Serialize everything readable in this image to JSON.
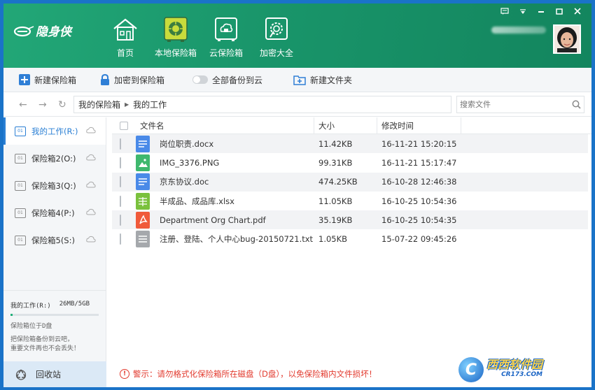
{
  "app": {
    "logo_mark": "e",
    "logo_text": "隐身侠"
  },
  "nav": [
    {
      "label": "首页",
      "icon": "home-icon"
    },
    {
      "label": "本地保险箱",
      "icon": "safe-icon"
    },
    {
      "label": "云保险箱",
      "icon": "cloud-safe-icon"
    },
    {
      "label": "加密大全",
      "icon": "encrypt-gear-icon"
    }
  ],
  "window_controls": [
    "message-icon",
    "dropdown-icon",
    "minimize-icon",
    "maximize-icon",
    "close-icon"
  ],
  "toolbar": {
    "new_vault": "新建保险箱",
    "encrypt_to_vault": "加密到保险箱",
    "backup_all": "全部备份到云",
    "new_folder": "新建文件夹"
  },
  "address": {
    "crumbs": [
      "我的保险箱",
      "我的工作"
    ],
    "search_placeholder": "搜索文件"
  },
  "sidebar": {
    "vaults": [
      {
        "label": "我的工作(R:)",
        "active": true
      },
      {
        "label": "保险箱2(O:)",
        "active": false
      },
      {
        "label": "保险箱3(Q:)",
        "active": false
      },
      {
        "label": "保险箱4(P:)",
        "active": false
      },
      {
        "label": "保险箱5(S:)",
        "active": false
      }
    ],
    "usage": {
      "name": "我的工作(R:)",
      "size": "26MB/5GB",
      "fraction": 0.005
    },
    "location_note": "保险箱位于D盘",
    "tip_line1": "把保险箱备份到云吧，",
    "tip_line2": "重要文件再也不会丢失！",
    "recycle": "回收站"
  },
  "table": {
    "headers": {
      "name": "文件名",
      "size": "大小",
      "modified": "修改时间"
    },
    "rows": [
      {
        "name": "岗位职责.docx",
        "size": "11.42KB",
        "modified": "16-11-21 15:20:15",
        "type": "doc",
        "color": "#4a8ae8"
      },
      {
        "name": "IMG_3376.PNG",
        "size": "99.31KB",
        "modified": "16-11-21 15:17:47",
        "type": "image",
        "color": "#3fb86e"
      },
      {
        "name": "京东协议.doc",
        "size": "474.25KB",
        "modified": "16-10-28 12:46:38",
        "type": "doc",
        "color": "#4a8ae8"
      },
      {
        "name": "半成品、成品库.xlsx",
        "size": "11.05KB",
        "modified": "16-10-25 10:54:36",
        "type": "sheet",
        "color": "#7ac13d"
      },
      {
        "name": "Department Org Chart.pdf",
        "size": "35.19KB",
        "modified": "16-10-25 10:54:35",
        "type": "pdf",
        "color": "#f05a3a"
      },
      {
        "name": "注册、登陆、个人中心bug-20150721.txt",
        "size": "1.05KB",
        "modified": "15-07-22 09:45:26",
        "type": "txt",
        "color": "#a5a8ac"
      }
    ]
  },
  "warning": "警示：请勿格式化保险箱所在磁盘（D盘），以免保险箱内文件损坏！",
  "watermark": {
    "main": "西西软件园",
    "sub": "CR173.COM"
  }
}
